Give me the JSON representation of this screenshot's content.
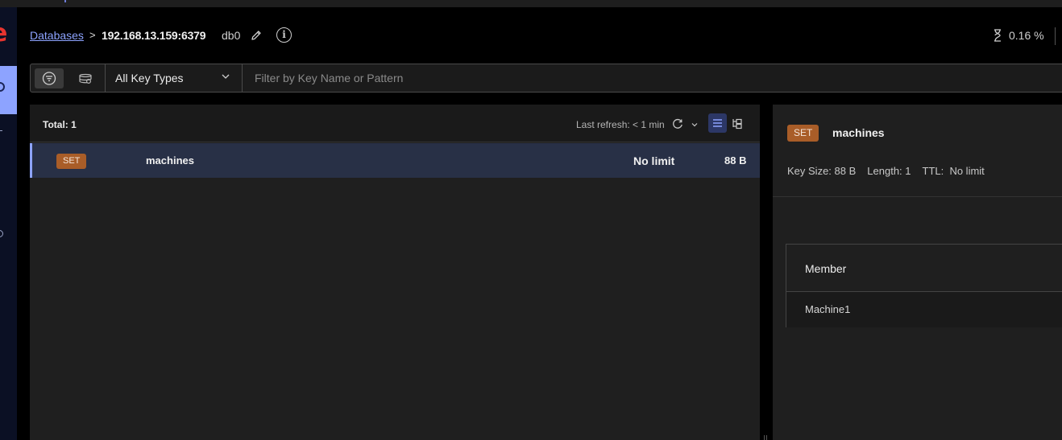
{
  "breadcrumb": {
    "databases_link": "Databases",
    "separator": ">",
    "host": "192.168.13.159:6379"
  },
  "db": {
    "name": "db0"
  },
  "cpu": {
    "value": "0.16 %"
  },
  "filter": {
    "key_type": "All Key Types",
    "placeholder": "Filter by Key Name or Pattern",
    "value": ""
  },
  "key_list": {
    "total": "Total: 1",
    "last_refresh": "Last refresh: < 1 min",
    "rows": [
      {
        "type": "SET",
        "name": "machines",
        "ttl": "No limit",
        "size": "88 B"
      }
    ]
  },
  "details": {
    "type": "SET",
    "name": "machines",
    "key_size": "Key Size: 88 B",
    "length": "Length: 1",
    "ttl": "TTL:  No limit",
    "column_header": "Member",
    "members": [
      "Machine1"
    ]
  },
  "colors": {
    "accent": "#8da3ff",
    "set_badge": "#a95d28",
    "logo": "#e8342f",
    "nav_background": "#0b1024"
  },
  "icons": [
    "logo-icon",
    "pencil-icon",
    "info-icon",
    "cpu-icon",
    "filter-icon",
    "search-icon",
    "chevron-down-icon",
    "refresh-icon",
    "list-view-icon",
    "tree-view-icon"
  ]
}
